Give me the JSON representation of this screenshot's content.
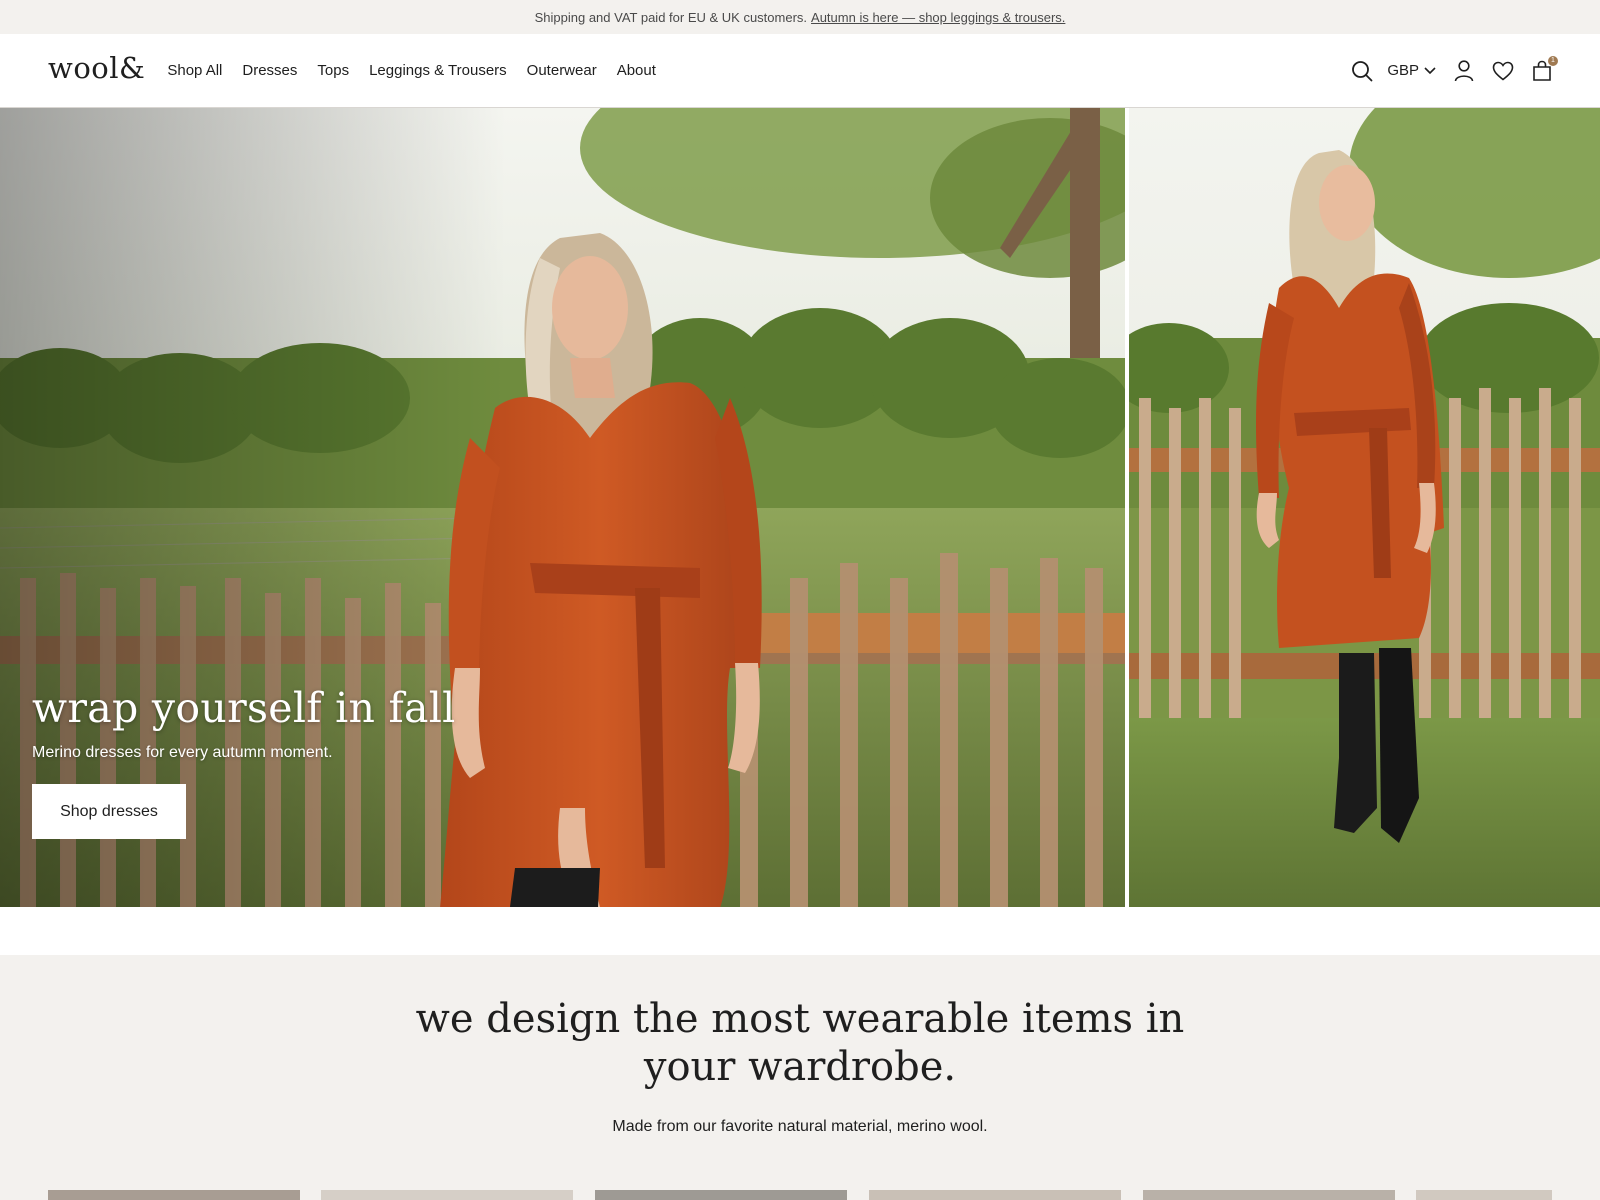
{
  "announcement": {
    "text": "Shipping and VAT paid for EU & UK customers.",
    "link": "Autumn is here — shop leggings & trousers."
  },
  "header": {
    "logo": "wool&",
    "nav": [
      "Shop All",
      "Dresses",
      "Tops",
      "Leggings & Trousers",
      "Outerwear",
      "About"
    ],
    "currency": "GBP",
    "cart_count": "1",
    "icons": [
      "search-icon",
      "chevron-down-icon",
      "user-icon",
      "heart-icon",
      "bag-icon"
    ]
  },
  "hero": {
    "title": "wrap yourself in fall",
    "subtitle": "Merino dresses for every autumn moment.",
    "cta": "Shop dresses"
  },
  "about": {
    "title": "we design the most wearable items in your wardrobe.",
    "subtitle": "Made from our favorite natural material, merino wool."
  },
  "colors": {
    "announce_bg": "#f3f1ee",
    "accent_badge": "#a07a52",
    "dress": "#c4521f",
    "section_bg": "#f3f1ee"
  }
}
